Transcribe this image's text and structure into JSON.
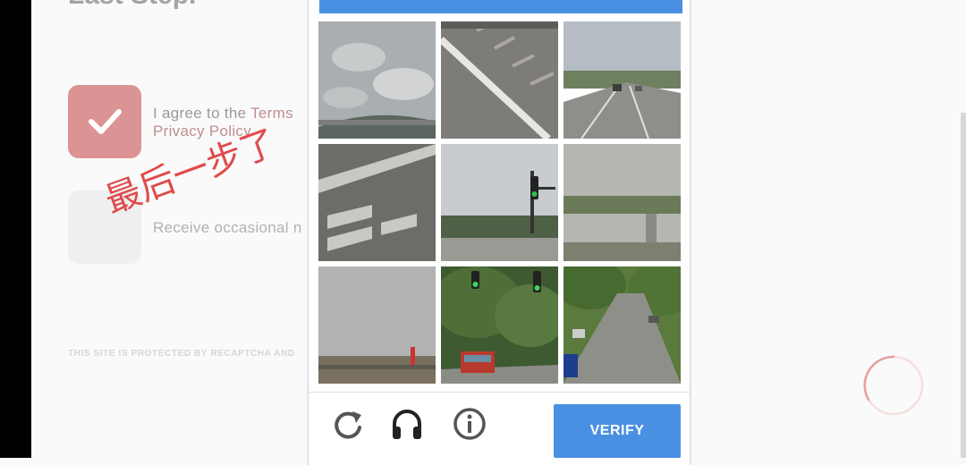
{
  "page": {
    "heading": "Last Step.",
    "agree_prefix": "I agree to the ",
    "agree_link": "Terms",
    "privacy_link": "Privacy Policy",
    "receive_text": "Receive occasional n",
    "recaptcha_note": "THIS SITE IS PROTECTED BY RECAPTCHA AND"
  },
  "overlay_text": "最后一步了",
  "challenge": {
    "header_color": "#4a90e2",
    "tiles": [
      {
        "scene": "sky-clouds-bridge"
      },
      {
        "scene": "road-line-diagonal"
      },
      {
        "scene": "highway-cars"
      },
      {
        "scene": "crosswalk-stripes"
      },
      {
        "scene": "traffic-light-street"
      },
      {
        "scene": "overpass-trees"
      },
      {
        "scene": "sky-traffic-light"
      },
      {
        "scene": "tree-street-traffic-lights"
      },
      {
        "scene": "road-parked-cars"
      }
    ],
    "verify_label": "VERIFY",
    "reload_icon": "reload-icon",
    "audio_icon": "headphones-icon",
    "info_icon": "info-icon"
  },
  "colors": {
    "accent": "#4a90e2",
    "checked_box": "#dc9393",
    "overlay": "#e04a4a"
  }
}
